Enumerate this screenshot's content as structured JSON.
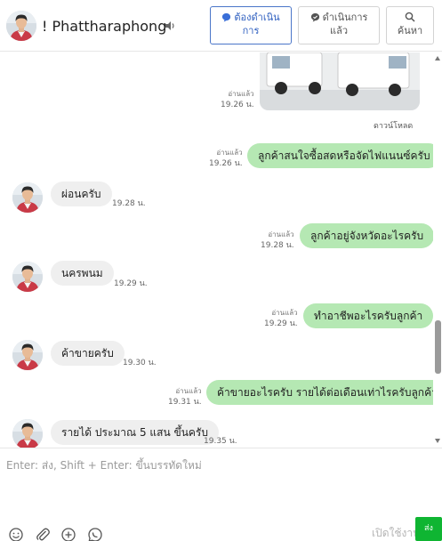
{
  "header": {
    "contact_name": "! Phattharaphong",
    "todo_line1": "ต้องดำเนิน",
    "todo_line2": "การ",
    "done_line1": "ดำเนินการ",
    "done_line2": "แล้ว",
    "search_label": "ค้นหา"
  },
  "chat": {
    "download_label": "ดาวน์โหลด",
    "messages": [
      {
        "side": "out",
        "read": "อ่านแล้ว",
        "time": "19.26 น.",
        "text": ""
      },
      {
        "side": "out",
        "read": "อ่านแล้ว",
        "time": "19.26 น.",
        "text": "ลูกค้าสนใจซื้อสดหรือจัดไฟแนนซ์ครับ"
      },
      {
        "side": "in",
        "time": "19.28 น.",
        "text": "ผ่อนครับ"
      },
      {
        "side": "out",
        "read": "อ่านแล้ว",
        "time": "19.28 น.",
        "text": "ลูกค้าอยู่จังหวัดอะไรครับ"
      },
      {
        "side": "in",
        "time": "19.29 น.",
        "text": "นครพนม"
      },
      {
        "side": "out",
        "read": "อ่านแล้ว",
        "time": "19.29 น.",
        "text": "ทำอาชีพอะไรครับลูกค้า"
      },
      {
        "side": "in",
        "time": "19.30 น.",
        "text": "ค้าขายครับ"
      },
      {
        "side": "out",
        "read": "อ่านแล้ว",
        "time": "19.31 น.",
        "text": "ค้าขายอะไรครับ รายได้ต่อเดือนเท่าไรครับลูกค้า"
      },
      {
        "side": "in",
        "time": "19.35 น.",
        "text": "รายได้ ประมาณ 5 แสน ขึ้นครับ"
      }
    ]
  },
  "composer": {
    "placeholder": "Enter: ส่ง, Shift + Enter: ขึ้นบรรทัดใหม่",
    "send_label": "ส่ง",
    "open_text": "เปิดใช้งาน"
  },
  "icons": [
    "speaker-icon",
    "chat-bubble-icon",
    "check-bubble-icon",
    "search-icon",
    "emoji-icon",
    "paperclip-icon",
    "add-circle-icon",
    "whatsapp-icon"
  ],
  "colors": {
    "outgoing_bubble": "#b5e8b3",
    "incoming_bubble": "#efefef",
    "send_button": "#0fb532",
    "todo_accent": "#3060c0"
  }
}
